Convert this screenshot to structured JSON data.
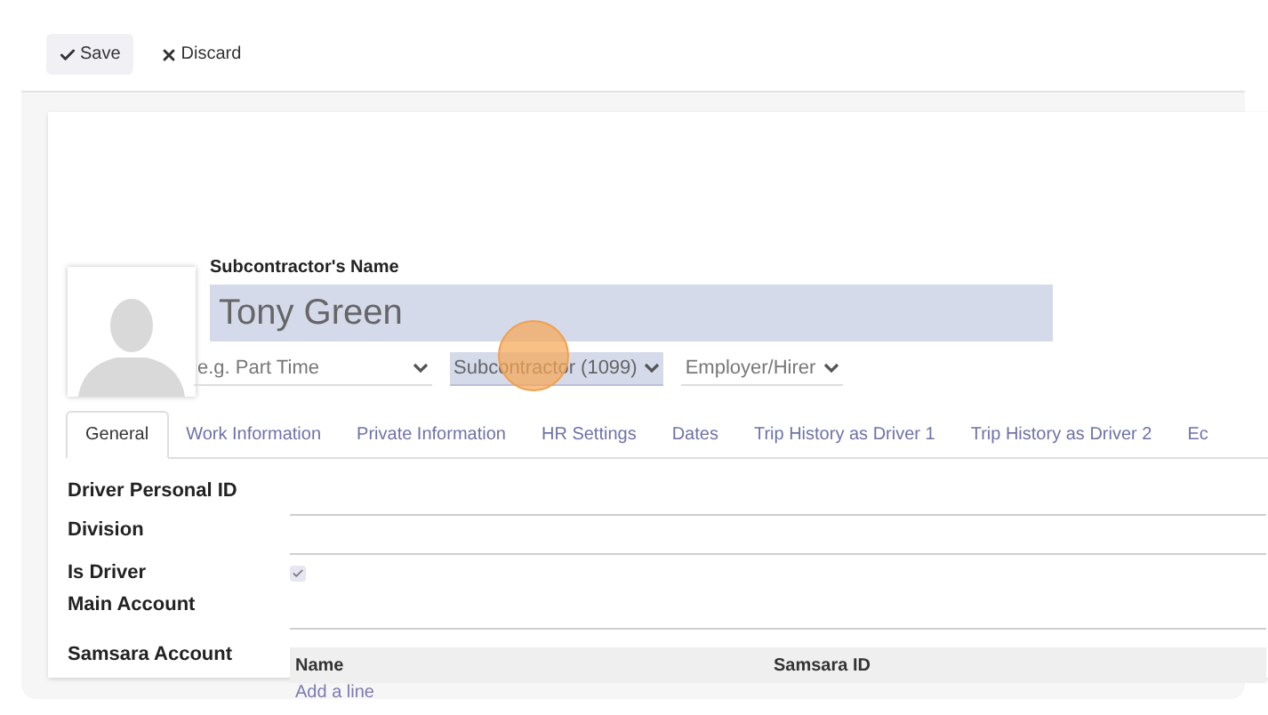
{
  "toolbar": [
    {
      "label": "Save",
      "kind": "save"
    },
    {
      "label": "Discard",
      "kind": "discard"
    }
  ],
  "header": {
    "name_label": "Subcontractor's Name",
    "name": "Tony Green",
    "selects": [
      {
        "placeholder": "e.g. Part Time",
        "selected": false
      },
      {
        "value": "Subcontractor (1099)",
        "selected": true
      },
      {
        "value": "Employer/Hirer",
        "selected": false
      }
    ]
  },
  "tabs": [
    {
      "label": "General",
      "selected": true
    },
    {
      "label": "Work Information",
      "selected": false
    },
    {
      "label": "Private Information",
      "selected": false
    },
    {
      "label": "HR Settings",
      "selected": false
    },
    {
      "label": "Dates",
      "selected": false
    },
    {
      "label": "Trip History as Driver 1",
      "selected": false
    },
    {
      "label": "Trip History as Driver 2",
      "selected": false
    },
    {
      "label": "Ec",
      "selected": false
    }
  ],
  "fields": [
    {
      "label": "Driver Personal ID",
      "kind": "text"
    },
    {
      "label": "Division",
      "kind": "text"
    },
    {
      "label": "Is Driver",
      "kind": "checkbox",
      "checked": true
    },
    {
      "label": "Main Account",
      "kind": "text"
    },
    {
      "label": "Samsara Account",
      "kind": "table",
      "columns": [
        "Name",
        "Samsara ID"
      ],
      "add_line": "Add a line"
    }
  ]
}
